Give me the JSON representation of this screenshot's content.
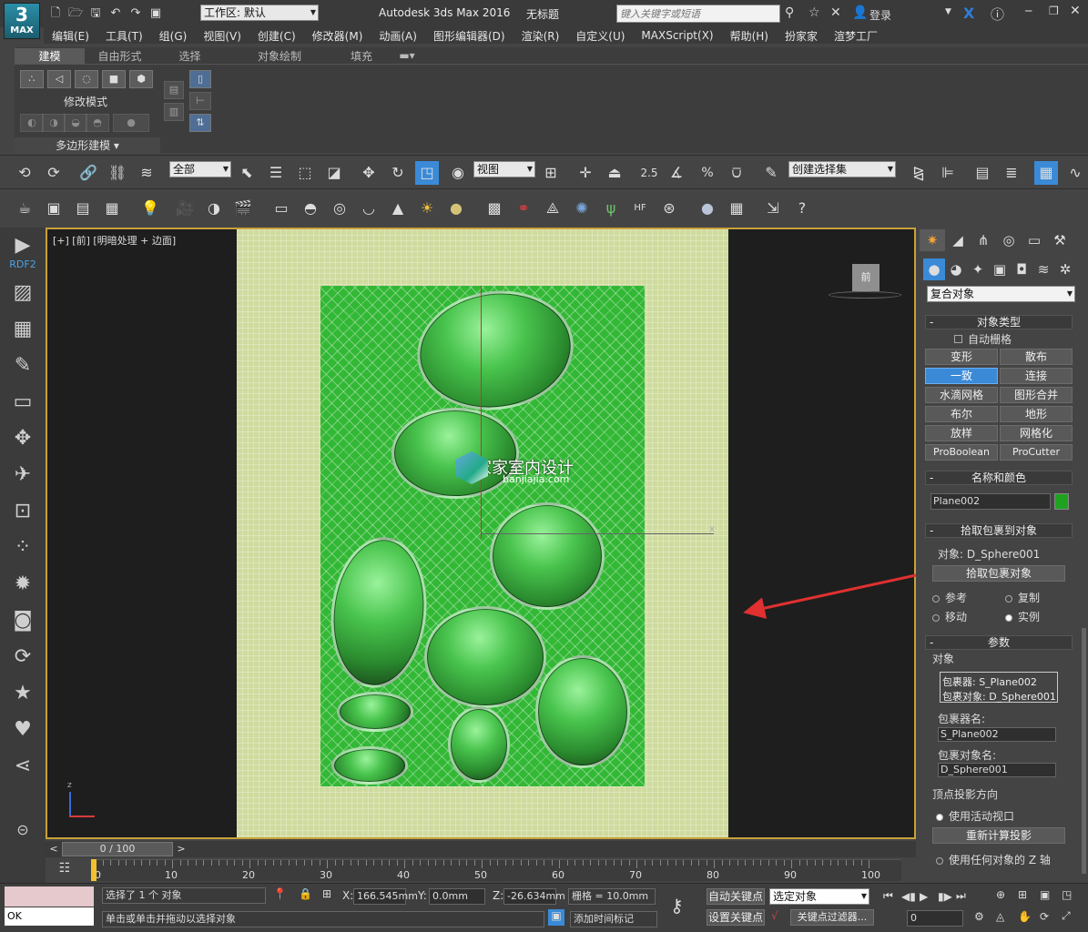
{
  "app": {
    "logo_text": "MAX",
    "title": "Autodesk 3ds Max 2016",
    "doc_title": "无标题",
    "workspace_label": "工作区: 默认",
    "search_placeholder": "键入关键字或短语",
    "login_label": "登录"
  },
  "menu": [
    "编辑(E)",
    "工具(T)",
    "组(G)",
    "视图(V)",
    "创建(C)",
    "修改器(M)",
    "动画(A)",
    "图形编辑器(D)",
    "渲染(R)",
    "自定义(U)",
    "MAXScript(X)",
    "帮助(H)",
    "扮家家",
    "渲梦工厂"
  ],
  "ribbon": {
    "tabs": [
      "建模",
      "自由形式",
      "选择",
      "对象绘制",
      "填充"
    ],
    "group_label": "修改模式",
    "panel_label": "多边形建模"
  },
  "toolbar1": {
    "filter_value": "全部",
    "refcoord_value": "视图",
    "angle_snap": "2.5",
    "percent_snap": "%",
    "selection_set": "创建选择集"
  },
  "leftbar": {
    "label": "RDF2"
  },
  "viewport": {
    "label": "[+] [前] [明暗处理 + 边面]",
    "watermark": "扮家家室内设计",
    "watermark_sub": "banjiajia.com",
    "cube_label": "前",
    "axis_z": "z",
    "axis_x": "x"
  },
  "panel": {
    "category_dropdown": "复合对象",
    "object_type_title": "对象类型",
    "autogrid_label": "自动栅格",
    "object_buttons": [
      "变形",
      "散布",
      "一致",
      "连接",
      "水滴网格",
      "图形合并",
      "布尔",
      "地形",
      "放样",
      "网格化",
      "ProBoolean",
      "ProCutter"
    ],
    "selected_button": "一致",
    "name_color_title": "名称和颜色",
    "object_name": "Plane002",
    "object_color": "#1fa21f",
    "pick_title": "拾取包裹到对象",
    "pick_object_label": "对象: D_Sphere001",
    "pick_button": "拾取包裹对象",
    "radio_reference": "参考",
    "radio_copy": "复制",
    "radio_move": "移动",
    "radio_instance": "实例",
    "params_title": "参数",
    "objects_group": "对象",
    "wrapper_line": "包裹器: S_Plane002",
    "wrap_object_line": "包裹对象: D_Sphere001",
    "wrapper_name_label": "包裹器名:",
    "wrapper_name_value": "S_Plane002",
    "wrap_object_name_label": "包裹对象名:",
    "wrap_object_name_value": "D_Sphere001",
    "vertex_proj_title": "顶点投影方向",
    "use_active_viewport": "使用活动视口",
    "recalc_projection": "重新计算投影",
    "use_any_z": "使用任何对象的 Z 轴"
  },
  "timeline": {
    "frame_label": "0 / 100",
    "prev": "<",
    "next": ">",
    "ticks": [
      "0",
      "10",
      "20",
      "30",
      "40",
      "50",
      "60",
      "70",
      "80",
      "90",
      "100"
    ]
  },
  "status": {
    "script_value": "OK",
    "selection_info": "选择了 1 个 对象",
    "prompt": "单击或单击并拖动以选择对象",
    "x_label": "X:",
    "x_value": "166.545mm",
    "y_label": "Y:",
    "y_value": "0.0mm",
    "z_label": "Z:",
    "z_value": "-26.634mm",
    "grid_label": "栅格 = 10.0mm",
    "add_time_tag": "添加时间标记",
    "autokey": "自动关键点",
    "setkey": "设置关键点",
    "selected_dropdown": "选定对象",
    "key_filters": "关键点过滤器...",
    "frame_value": "0"
  },
  "colors": {
    "accent": "#3a8ad8",
    "viewport_border": "#c7a23a",
    "arrow": "#e03030"
  }
}
